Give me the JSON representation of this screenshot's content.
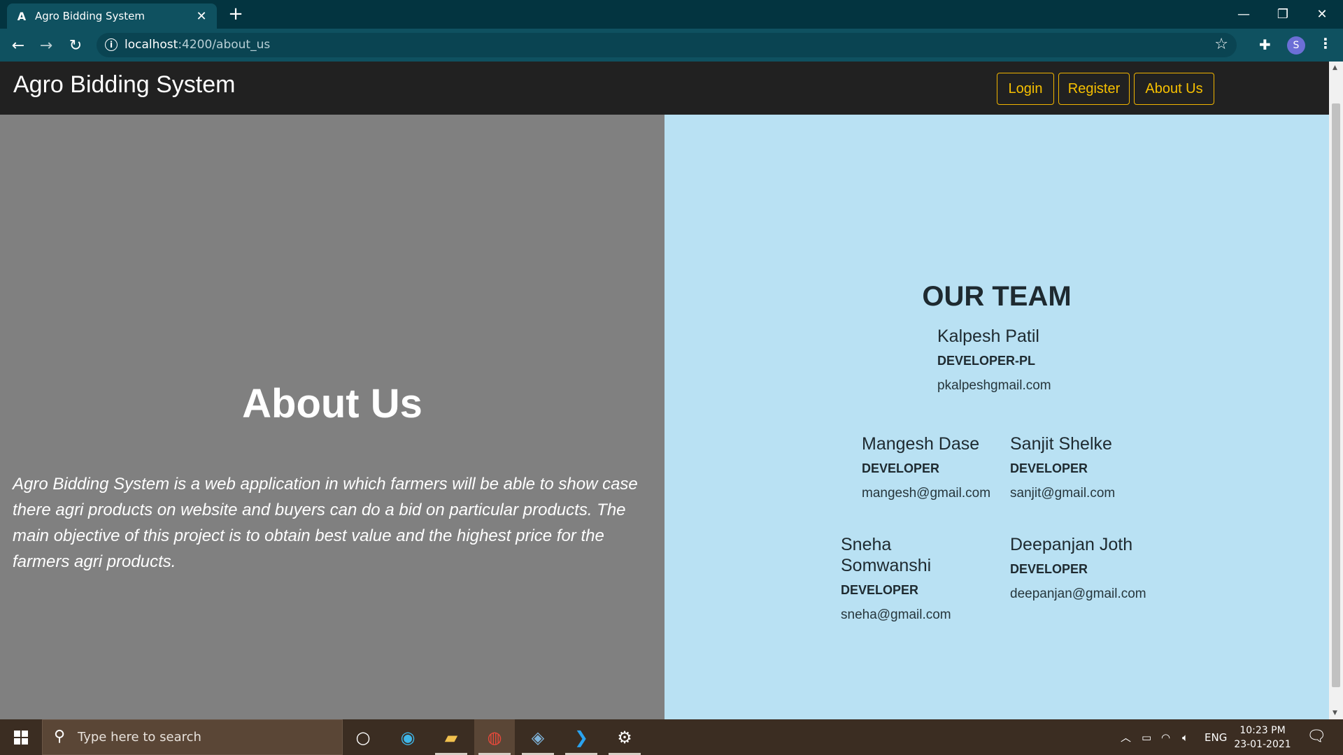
{
  "browser": {
    "tab_title": "Agro Bidding System",
    "tab_favicon": "A",
    "url_host": "localhost",
    "url_rest": ":4200/about_us",
    "profile_initial": "S"
  },
  "navbar": {
    "brand": "Agro Bidding System",
    "login_label": "Login",
    "register_label": "Register",
    "about_label": "About Us",
    "accent_color": "#f0b400"
  },
  "about": {
    "title": "About Us",
    "description": "Agro Bidding System is a web application in which farmers will be able to show case there agri products on website and buyers can do a bid on particular products. The main objective of this project is to obtain best value and the highest price for the farmers agri products."
  },
  "team": {
    "title": "OUR TEAM",
    "members": [
      {
        "name": "Kalpesh Patil",
        "role": "DEVELOPER-PL",
        "email": "pkalpeshgmail.com"
      },
      {
        "name": "Mangesh Dase",
        "role": "DEVELOPER",
        "email": "mangesh@gmail.com"
      },
      {
        "name": "Sanjit Shelke",
        "role": "DEVELOPER",
        "email": "sanjit@gmail.com"
      },
      {
        "name": "Sneha Somwanshi",
        "role": "DEVELOPER",
        "email": "sneha@gmail.com"
      },
      {
        "name": "Deepanjan Joth",
        "role": "DEVELOPER",
        "email": "deepanjan@gmail.com"
      }
    ]
  },
  "taskbar": {
    "search_placeholder": "Type here to search",
    "language": "ENG",
    "time": "10:23 PM",
    "date": "23-01-2021"
  }
}
